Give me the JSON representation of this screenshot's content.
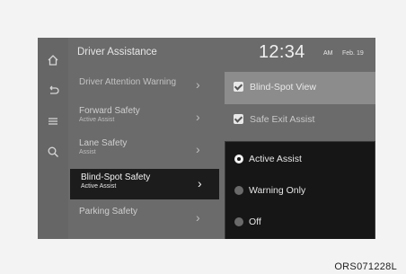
{
  "header": {
    "title": "Driver Assistance",
    "time": "12:34",
    "ampm": "AM",
    "date": "Feb. 19"
  },
  "rail": {
    "icons": [
      "home-icon",
      "back-icon",
      "menu-icon",
      "search-icon"
    ]
  },
  "menu": [
    {
      "label": "Driver Attention Warning",
      "sub": ""
    },
    {
      "label": "Forward Safety",
      "sub": "Active Assist"
    },
    {
      "label": "Lane Safety",
      "sub": "Assist"
    },
    {
      "label": "Blind-Spot Safety",
      "sub": "Active Assist",
      "selected": true
    },
    {
      "label": "Parking Safety",
      "sub": ""
    }
  ],
  "options": [
    {
      "label": "Blind-Spot View",
      "checked": true
    },
    {
      "label": "Safe Exit Assist",
      "checked": true
    }
  ],
  "popup": [
    {
      "label": "Active Assist",
      "selected": true
    },
    {
      "label": "Warning Only",
      "selected": false
    },
    {
      "label": "Off",
      "selected": false
    }
  ],
  "code": "ORS071228L"
}
